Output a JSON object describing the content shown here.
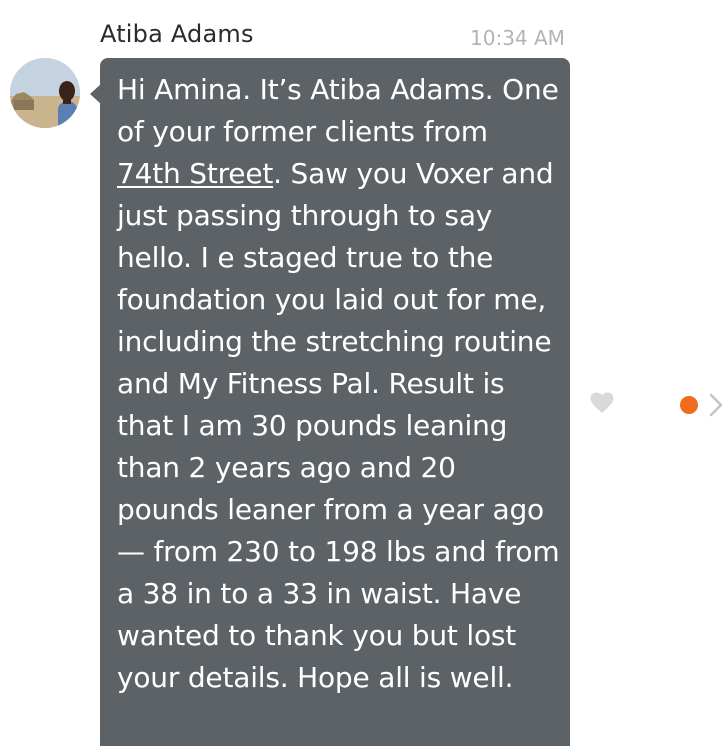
{
  "message": {
    "sender": "Atiba Adams",
    "time": "10:34 AM",
    "text_before_link": "Hi Amina. It’s Atiba Adams. One of your former clients from ",
    "link_text": "74th Street",
    "text_after_link": ". Saw you Voxer and just passing through to say hello. I e staged true to the foundation you laid out for me, including the stretching routine and My Fitness Pal. Result is that I am 30 pounds leaning than 2 years ago and 20 pounds leaner from a year ago — from 230 to 198 lbs and from a 38 in to a 33 in waist. Have wanted to thank you but lost your details. Hope all is well."
  },
  "icons": {
    "avatar": "avatar",
    "like": "heart-icon",
    "unread": "unread-dot-icon",
    "more": "chevron-right-icon"
  },
  "colors": {
    "bubble": "#5d6266",
    "heart": "#d9d9d9",
    "unread_dot": "#f26b1d",
    "chevron": "#c4c4c4"
  }
}
